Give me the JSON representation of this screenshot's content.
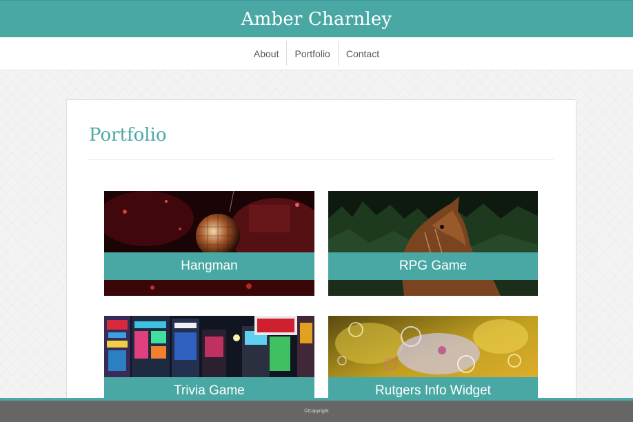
{
  "header": {
    "site_title": "Amber Charnley"
  },
  "nav": {
    "items": [
      "About",
      "Portfolio",
      "Contact"
    ]
  },
  "main": {
    "heading": "Portfolio",
    "cards": [
      {
        "label": "Hangman",
        "image": "disco-ball-photo"
      },
      {
        "label": "RPG Game",
        "image": "horse-photo"
      },
      {
        "label": "Trivia Game",
        "image": "city-night-street-photo"
      },
      {
        "label": "Rutgers Info Widget",
        "image": "oil-water-bubbles-photo"
      }
    ]
  },
  "footer": {
    "text": "©Copyright"
  },
  "colors": {
    "accent": "#4aa8a4",
    "footer_bg": "#666666"
  }
}
